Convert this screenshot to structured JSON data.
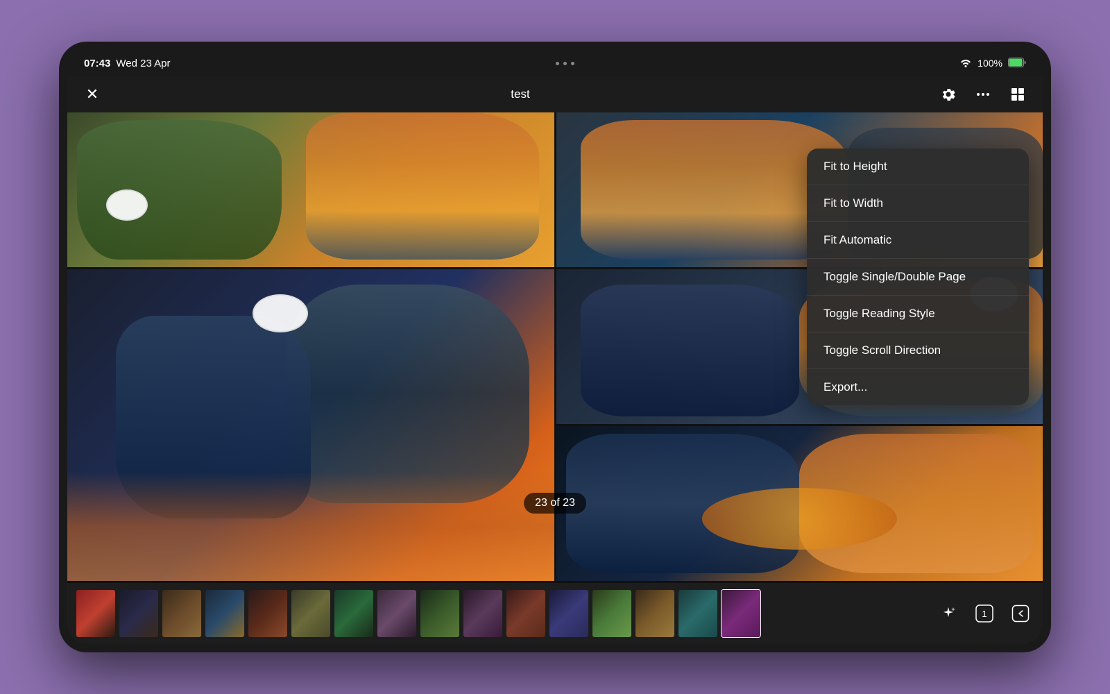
{
  "statusBar": {
    "time": "07:43",
    "date": "Wed 23 Apr",
    "battery": "100%"
  },
  "appBar": {
    "title": "test",
    "closeBtn": "✕"
  },
  "pageIndicator": "23 of 23",
  "contextMenu": {
    "items": [
      {
        "id": "fit-to-height",
        "label": "Fit to Height"
      },
      {
        "id": "fit-to-width",
        "label": "Fit to Width"
      },
      {
        "id": "fit-automatic",
        "label": "Fit Automatic"
      },
      {
        "id": "toggle-single-double",
        "label": "Toggle Single/Double Page"
      },
      {
        "id": "toggle-reading-style",
        "label": "Toggle Reading Style"
      },
      {
        "id": "toggle-scroll-direction",
        "label": "Toggle Scroll Direction"
      },
      {
        "id": "export",
        "label": "Export..."
      }
    ]
  },
  "thumbnails": {
    "count": 16,
    "activeIndex": 15
  },
  "icons": {
    "close": "✕",
    "settings": "⚙",
    "more": "···",
    "grid": "⊞",
    "sparkle": "✦",
    "number": "1",
    "back": "↩"
  }
}
